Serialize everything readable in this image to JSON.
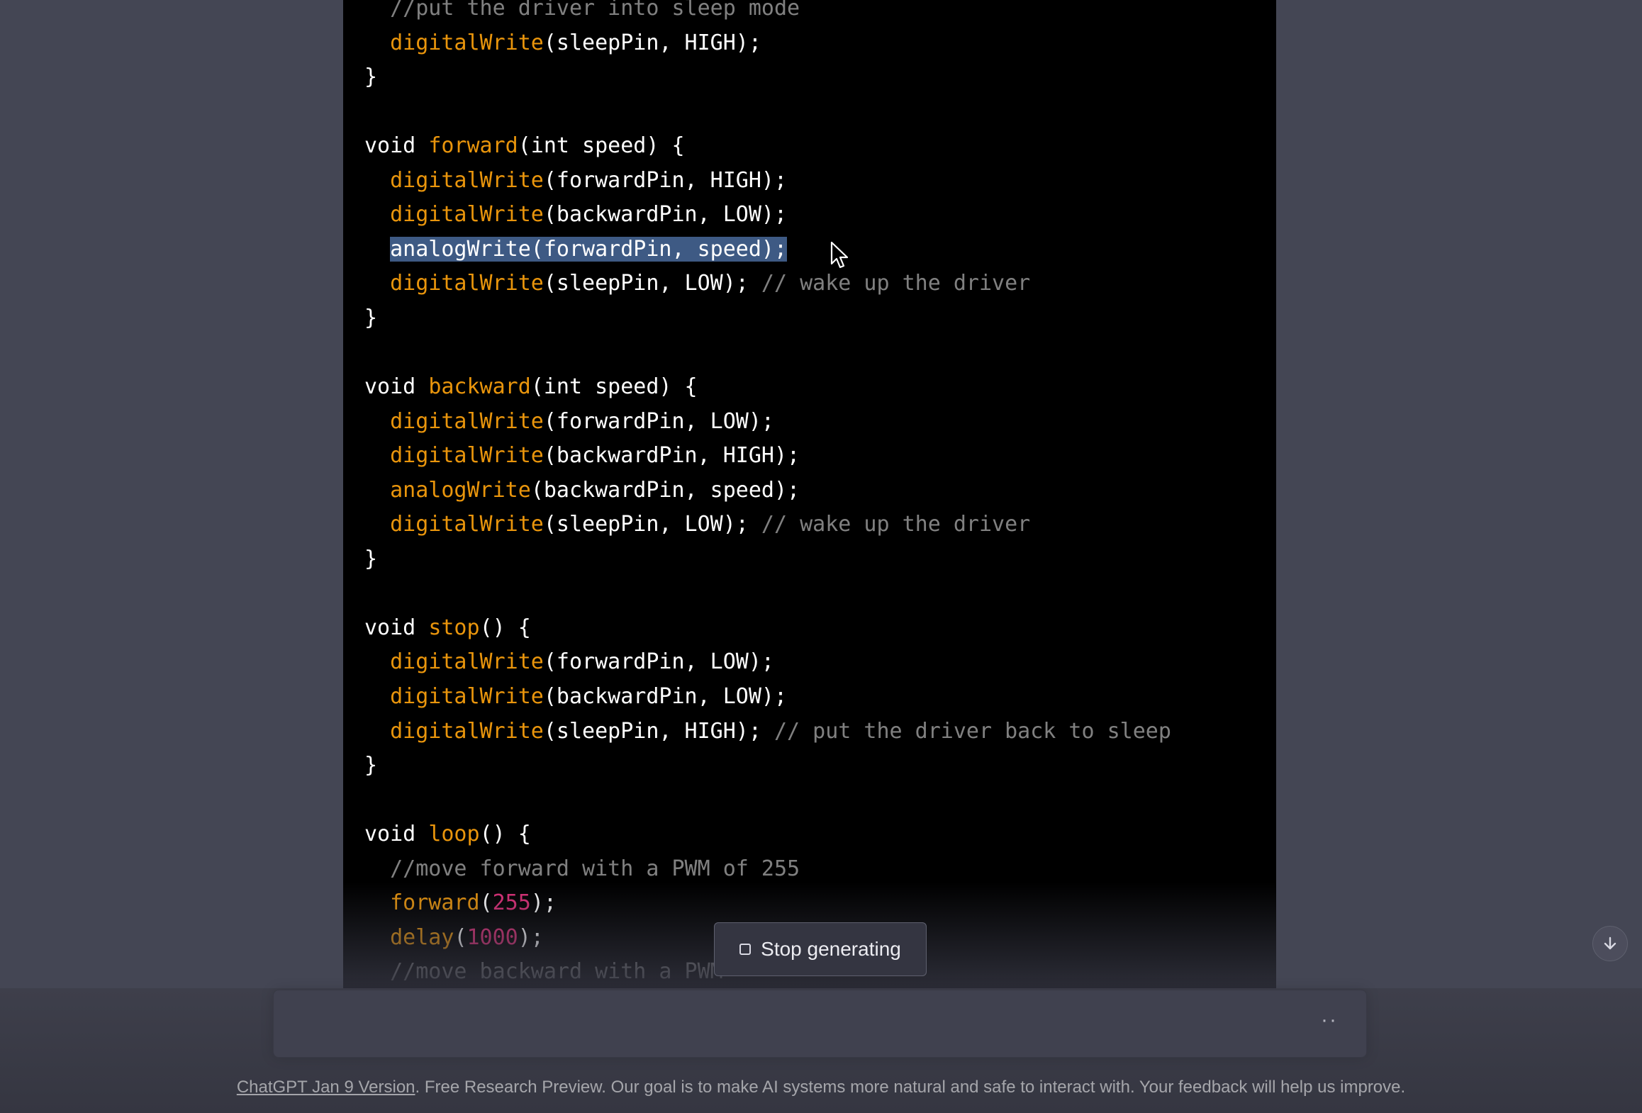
{
  "code_lines": [
    [
      [
        "comment",
        "  //put the driver into sleep mode"
      ]
    ],
    [
      [
        "plain",
        "  "
      ],
      [
        "fn",
        "digitalWrite"
      ],
      [
        "plain",
        "(sleepPin, HIGH);"
      ]
    ],
    [
      [
        "plain",
        "}"
      ]
    ],
    [],
    [
      [
        "plain",
        "void "
      ],
      [
        "fn",
        "forward"
      ],
      [
        "plain",
        "(int speed) {"
      ]
    ],
    [
      [
        "plain",
        "  "
      ],
      [
        "fn",
        "digitalWrite"
      ],
      [
        "plain",
        "(forwardPin, HIGH);"
      ]
    ],
    [
      [
        "plain",
        "  "
      ],
      [
        "fn",
        "digitalWrite"
      ],
      [
        "plain",
        "(backwardPin, LOW);"
      ]
    ],
    [
      [
        "plain",
        "  "
      ],
      [
        "sel",
        "analogWrite(forwardPin, speed);"
      ]
    ],
    [
      [
        "plain",
        "  "
      ],
      [
        "fn",
        "digitalWrite"
      ],
      [
        "plain",
        "(sleepPin, LOW); "
      ],
      [
        "comment",
        "// wake up the driver"
      ]
    ],
    [
      [
        "plain",
        "}"
      ]
    ],
    [],
    [
      [
        "plain",
        "void "
      ],
      [
        "fn",
        "backward"
      ],
      [
        "plain",
        "(int speed) {"
      ]
    ],
    [
      [
        "plain",
        "  "
      ],
      [
        "fn",
        "digitalWrite"
      ],
      [
        "plain",
        "(forwardPin, LOW);"
      ]
    ],
    [
      [
        "plain",
        "  "
      ],
      [
        "fn",
        "digitalWrite"
      ],
      [
        "plain",
        "(backwardPin, HIGH);"
      ]
    ],
    [
      [
        "plain",
        "  "
      ],
      [
        "fn",
        "analogWrite"
      ],
      [
        "plain",
        "(backwardPin, speed);"
      ]
    ],
    [
      [
        "plain",
        "  "
      ],
      [
        "fn",
        "digitalWrite"
      ],
      [
        "plain",
        "(sleepPin, LOW); "
      ],
      [
        "comment",
        "// wake up the driver"
      ]
    ],
    [
      [
        "plain",
        "}"
      ]
    ],
    [],
    [
      [
        "plain",
        "void "
      ],
      [
        "fn",
        "stop"
      ],
      [
        "plain",
        "() {"
      ]
    ],
    [
      [
        "plain",
        "  "
      ],
      [
        "fn",
        "digitalWrite"
      ],
      [
        "plain",
        "(forwardPin, LOW);"
      ]
    ],
    [
      [
        "plain",
        "  "
      ],
      [
        "fn",
        "digitalWrite"
      ],
      [
        "plain",
        "(backwardPin, LOW);"
      ]
    ],
    [
      [
        "plain",
        "  "
      ],
      [
        "fn",
        "digitalWrite"
      ],
      [
        "plain",
        "(sleepPin, HIGH); "
      ],
      [
        "comment",
        "// put the driver back to sleep"
      ]
    ],
    [
      [
        "plain",
        "}"
      ]
    ],
    [],
    [
      [
        "plain",
        "void "
      ],
      [
        "fn",
        "loop"
      ],
      [
        "plain",
        "() {"
      ]
    ],
    [
      [
        "comment",
        "  //move forward with a PWM of 255"
      ]
    ],
    [
      [
        "plain",
        "  "
      ],
      [
        "fn",
        "forward"
      ],
      [
        "plain",
        "("
      ],
      [
        "num",
        "255"
      ],
      [
        "plain",
        ");"
      ]
    ],
    [
      [
        "plain",
        "  "
      ],
      [
        "fn",
        "delay"
      ],
      [
        "plain",
        "("
      ],
      [
        "num",
        "1000"
      ],
      [
        "plain",
        ");"
      ]
    ],
    [
      [
        "comment",
        "  //move backward with a PWM"
      ]
    ]
  ],
  "stop_button": {
    "label": "Stop generating"
  },
  "composer": {
    "typing_indicator": "··"
  },
  "footer": {
    "link_text": "ChatGPT Jan 9 Version",
    "text": ". Free Research Preview. Our goal is to make AI systems more natural and safe to interact with. Your feedback will help us improve."
  },
  "colors": {
    "page_bg": "#444654",
    "code_bg": "#000000",
    "function": "#e9950c",
    "number": "#df3079",
    "selection": "#3e5a84"
  },
  "icons": {
    "stop": "stop-square-icon",
    "scroll_down": "arrow-down-icon",
    "cursor": "mouse-pointer-icon"
  }
}
